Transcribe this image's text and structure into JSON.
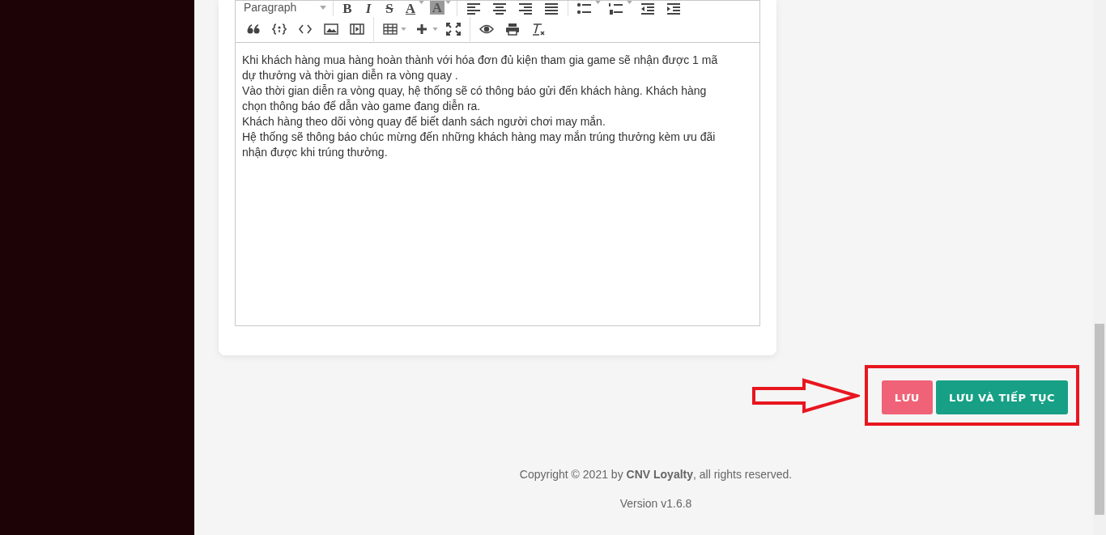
{
  "toolbar": {
    "rows": [
      [
        {
          "kind": "dropdown",
          "label": "Paragraph"
        },
        {
          "kind": "sep"
        },
        {
          "kind": "bold",
          "label": "B"
        },
        {
          "kind": "italic",
          "label": "I"
        },
        {
          "kind": "strike",
          "label": "S"
        },
        {
          "kind": "font-color",
          "label": "A"
        },
        {
          "kind": "highlight",
          "label": "A"
        },
        {
          "kind": "sep"
        },
        {
          "kind": "align-left"
        },
        {
          "kind": "align-center"
        },
        {
          "kind": "align-right"
        },
        {
          "kind": "align-justify"
        },
        {
          "kind": "sep"
        },
        {
          "kind": "bullet-list"
        },
        {
          "kind": "numbered-list"
        },
        {
          "kind": "outdent"
        },
        {
          "kind": "indent"
        }
      ],
      [
        {
          "kind": "quote"
        },
        {
          "kind": "code-block"
        },
        {
          "kind": "code"
        },
        {
          "kind": "image"
        },
        {
          "kind": "video"
        },
        {
          "kind": "sep"
        },
        {
          "kind": "table"
        },
        {
          "kind": "insert"
        },
        {
          "kind": "fullscreen"
        },
        {
          "kind": "sep"
        },
        {
          "kind": "preview"
        },
        {
          "kind": "print"
        },
        {
          "kind": "clear-format"
        }
      ]
    ]
  },
  "editor": {
    "paragraphs": [
      "Khi khách hàng mua hàng hoàn thành với hóa đơn đủ kiện tham gia game sẽ nhận được 1 mã dự thưởng và thời gian diễn ra vòng quay .",
      "Vào thời gian diễn ra vòng quay, hệ thống sẽ có thông báo gửi đến khách hàng. Khách hàng chọn thông báo để dẫn vào game đang diễn ra.",
      "Khách hàng theo dõi vòng quay để biết danh sách người chơi may mắn.",
      "Hệ thống sẽ thông báo chúc mừng đến những khách hàng may mắn trúng thưởng kèm ưu đãi nhận được khi trúng thưởng."
    ]
  },
  "buttons": [
    {
      "kind": "save",
      "label": "LƯU"
    },
    {
      "kind": "save-continue",
      "label": "LƯU VÀ TIẾP TỤC"
    }
  ],
  "footer": {
    "copyright": "Copyright © 2021 by **CNV Loyalty**, all rights reserved.",
    "version": "Version v1.6.8"
  }
}
